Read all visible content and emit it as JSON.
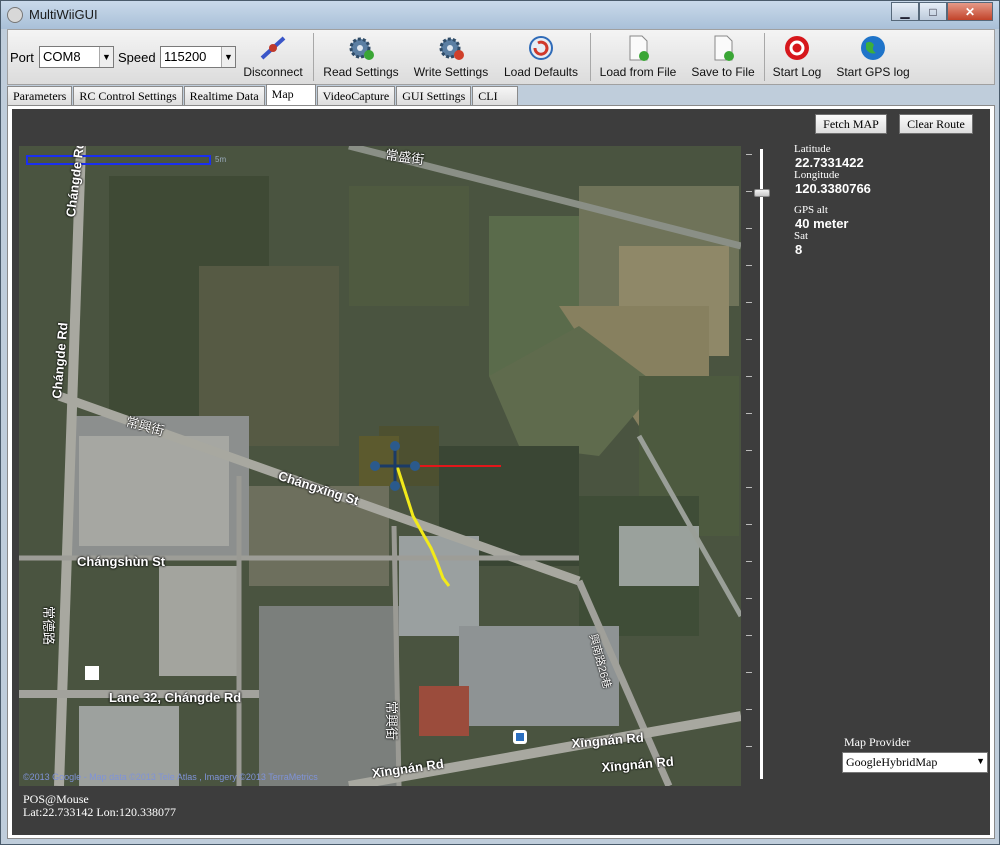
{
  "window": {
    "title": "MultiWiiGUI"
  },
  "toolbar": {
    "port_label": "Port",
    "port_value": "COM8",
    "speed_label": "Speed",
    "speed_value": "115200",
    "buttons": [
      {
        "label": "Disconnect",
        "icon": "disconnect-plug-icon"
      },
      {
        "label": "Read Settings",
        "icon": "gear-download-icon"
      },
      {
        "label": "Write Settings",
        "icon": "gear-upload-icon"
      },
      {
        "label": "Load Defaults",
        "icon": "refresh-icon"
      },
      {
        "label": "Load from File",
        "icon": "file-open-icon"
      },
      {
        "label": "Save to File",
        "icon": "file-save-icon"
      },
      {
        "label": "Start Log",
        "icon": "record-icon"
      },
      {
        "label": "Start GPS log",
        "icon": "globe-icon"
      }
    ]
  },
  "tabs": [
    "Parameters",
    "RC Control Settings",
    "Realtime Data",
    "Map",
    "VideoCapture",
    "GUI Settings",
    "CLI"
  ],
  "active_tab": "Map",
  "map": {
    "fetch_button": "Fetch MAP",
    "clear_button": "Clear Route",
    "latitude_label": "Latitude",
    "latitude_value": "22.7331422",
    "longitude_label": "Longitude",
    "longitude_value": "120.3380766",
    "gps_alt_label": "GPS alt",
    "gps_alt_value": "40 meter",
    "sat_label": "Sat",
    "sat_value": "8",
    "provider_label": "Map Provider",
    "provider_value": "GoogleHybridMap",
    "pos_title": "POS@Mouse",
    "pos_value": "Lat:22.733142 Lon:120.338077",
    "copyright": "©2013 Google - Map data ©2013 Tele Atlas , Imagery ©2013 TerraMetrics",
    "scale_text": "5m",
    "road_labels": {
      "changde_rd": "Chángde Rd",
      "changde_rd_2": "Chángde Rd",
      "changxing_st": "Chángxīng St",
      "changxing_cn": "常興街",
      "changshun_st": "Chángshùn St",
      "lane32": "Lane 32, Chángde Rd",
      "xingnan_rd": "Xīngnán Rd",
      "xingnan_rd_2": "Xīngnán Rd",
      "xingnan_rd_3": "Xīngnán Rd",
      "changsheng": "常盛街",
      "changde_cn": "常德路",
      "changxing_cn2": "常興街",
      "xingnan_lane": "興南路26巷"
    },
    "accent": {
      "track_yellow": "#f2ea1a",
      "heading_red": "#e3161a",
      "scale_blue": "#1a2ff0"
    }
  }
}
